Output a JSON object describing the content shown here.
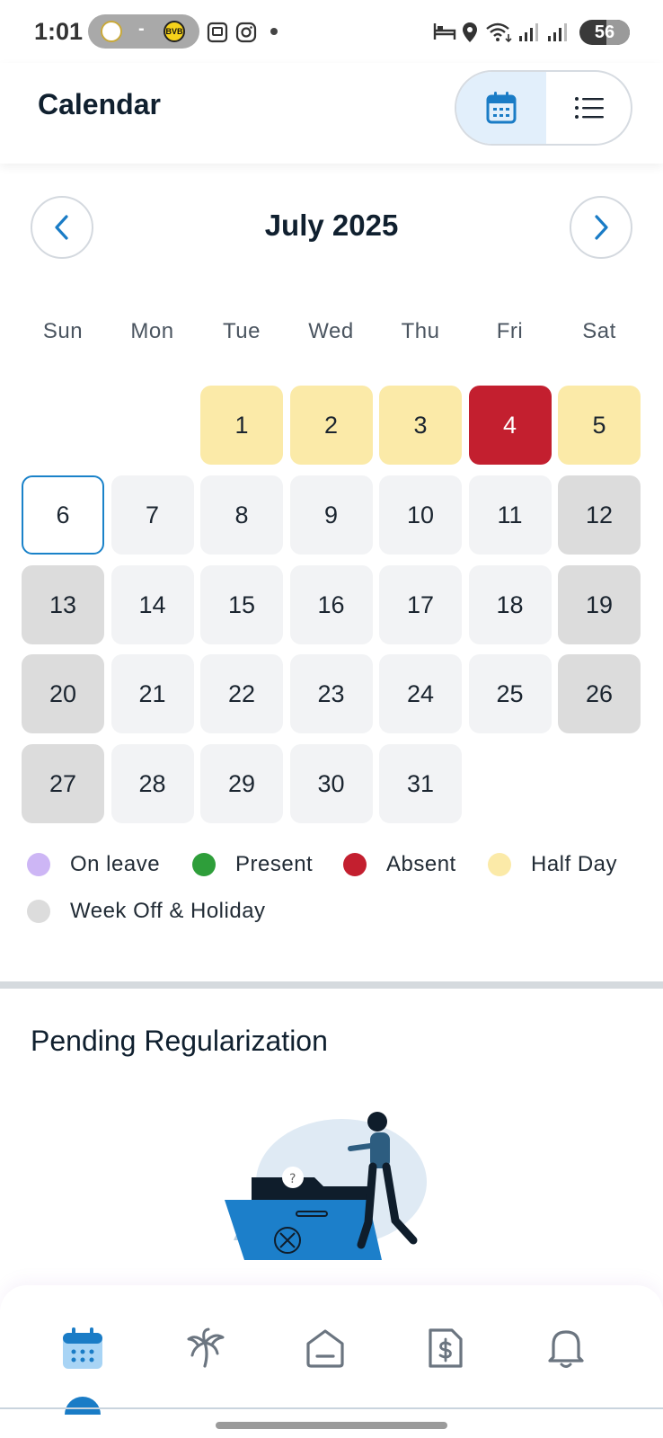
{
  "status_bar": {
    "time": "1:01",
    "score_separator": "-",
    "battery": "56",
    "icons": [
      "real-madrid-crest-icon",
      "bvb-crest-icon",
      "screenshot-icon",
      "instagram-icon",
      "dot-icon",
      "bed-icon",
      "location-icon",
      "wifi-icon",
      "signal-icon",
      "signal-icon"
    ]
  },
  "header": {
    "title": "Calendar",
    "views": [
      "calendar-view-icon",
      "list-view-icon"
    ],
    "active_view": "calendar"
  },
  "calendar": {
    "month_label": "July 2025",
    "weekdays": [
      "Sun",
      "Mon",
      "Tue",
      "Wed",
      "Thu",
      "Fri",
      "Sat"
    ],
    "days": [
      {
        "day": "1",
        "status": "half"
      },
      {
        "day": "2",
        "status": "half"
      },
      {
        "day": "3",
        "status": "half"
      },
      {
        "day": "4",
        "status": "absent"
      },
      {
        "day": "5",
        "status": "half"
      },
      {
        "day": "6",
        "status": "today"
      },
      {
        "day": "7",
        "status": "none"
      },
      {
        "day": "8",
        "status": "none"
      },
      {
        "day": "9",
        "status": "none"
      },
      {
        "day": "10",
        "status": "none"
      },
      {
        "day": "11",
        "status": "none"
      },
      {
        "day": "12",
        "status": "off"
      },
      {
        "day": "13",
        "status": "off"
      },
      {
        "day": "14",
        "status": "none"
      },
      {
        "day": "15",
        "status": "none"
      },
      {
        "day": "16",
        "status": "none"
      },
      {
        "day": "17",
        "status": "none"
      },
      {
        "day": "18",
        "status": "none"
      },
      {
        "day": "19",
        "status": "off"
      },
      {
        "day": "20",
        "status": "off"
      },
      {
        "day": "21",
        "status": "none"
      },
      {
        "day": "22",
        "status": "none"
      },
      {
        "day": "23",
        "status": "none"
      },
      {
        "day": "24",
        "status": "none"
      },
      {
        "day": "25",
        "status": "none"
      },
      {
        "day": "26",
        "status": "off"
      },
      {
        "day": "27",
        "status": "off"
      },
      {
        "day": "28",
        "status": "none"
      },
      {
        "day": "29",
        "status": "none"
      },
      {
        "day": "30",
        "status": "none"
      },
      {
        "day": "31",
        "status": "none"
      }
    ],
    "first_weekday_index": 2
  },
  "legend": [
    {
      "label": "On leave",
      "color": "#cdb6f5"
    },
    {
      "label": "Present",
      "color": "#2e9e3a"
    },
    {
      "label": "Absent",
      "color": "#c31f2f"
    },
    {
      "label": "Half Day",
      "color": "#fbeaa8"
    },
    {
      "label": "Week Off & Holiday",
      "color": "#dcdcdc"
    }
  ],
  "pending": {
    "title": "Pending Regularization"
  },
  "bottom_nav": {
    "tabs": [
      "calendar-icon",
      "palm-tree-icon",
      "home-icon",
      "invoice-dollar-icon",
      "bell-icon"
    ],
    "active_index": 0
  },
  "colors": {
    "accent": "#1a7cc6",
    "half": "#fbeaa8",
    "absent": "#c31f2f",
    "off": "#dcdcdc",
    "default_day": "#f2f3f5"
  }
}
